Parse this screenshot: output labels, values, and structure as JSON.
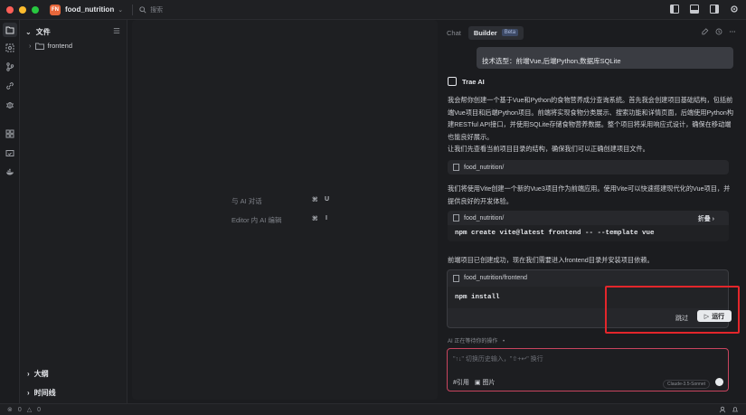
{
  "topbar": {
    "project_badge": "FN",
    "project_name": "food_nutrition",
    "search_placeholder": "搜索"
  },
  "explorer": {
    "title": "文件",
    "items": [
      {
        "label": "frontend"
      }
    ],
    "outline_label": "大纲",
    "timeline_label": "时间线"
  },
  "editor": {
    "hint_chat": "与 AI 对话",
    "hint_chat_keys": [
      "⌘",
      "U"
    ],
    "hint_edit": "Editor 内 AI 编辑",
    "hint_edit_keys": [
      "⌘",
      "I"
    ]
  },
  "panel": {
    "tab_chat": "Chat",
    "tab_builder": "Builder",
    "beta": "Beta",
    "user_message": "技术选型：前端Vue,后端Python,数据库SQLite",
    "ai_name": "Trae AI",
    "para1": "我会帮你创建一个基于Vue和Python的食物营养成分查询系统。首先我会创建项目基础结构，包括前端Vue项目和后端Python项目。前端将实现食物分类展示、搜索功能和详情页面，后端使用Python构建RESTful API接口，并使用SQLite存储食物营养数据。整个项目将采用响应式设计，确保在移动端也能良好展示。",
    "para2": "让我们先查看当前项目目录的结构，确保我们可以正确创建项目文件。",
    "ref1_path": "food_nutrition/",
    "para3": "我们将使用Vite创建一个新的Vue3项目作为前端应用。使用Vite可以快速搭建现代化的Vue项目，并提供良好的开发体验。",
    "ref2_path": "food_nutrition/",
    "ref2_collapse": "折叠",
    "ref2_command": "npm create vite@latest frontend -- --template vue",
    "para4": "前端项目已创建成功，现在我们需要进入frontend目录并安装项目依赖。",
    "action_path": "food_nutrition/frontend",
    "action_command": "npm install",
    "skip_label": "跳过",
    "run_label": "运行",
    "waiting_text": "AI 正在等待你的操作",
    "input_placeholder": "\"↑↓\" 切换历史输入，\"⇧+↩\" 换行",
    "tool_ref": "#引用",
    "tool_image": "图片",
    "model": "Claude-3.5-Sonnet"
  },
  "statusbar": {
    "errors": "0",
    "warnings": "0"
  },
  "colors": {
    "accent_red": "#e3262b",
    "project_badge": "#e7673b",
    "input_border": "#c8445e"
  }
}
